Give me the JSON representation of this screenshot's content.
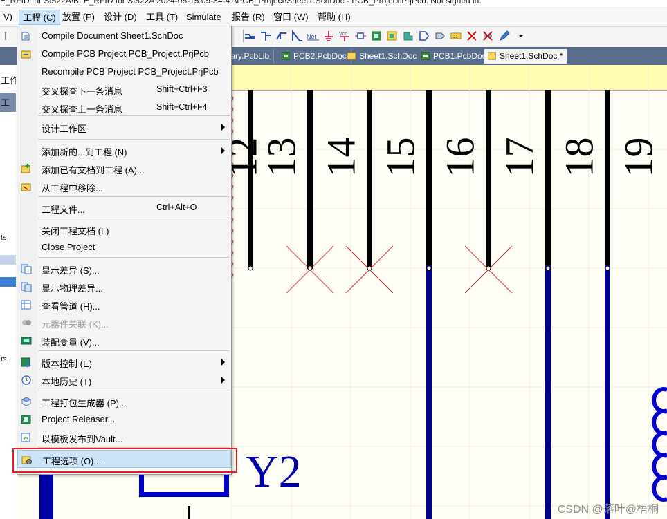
{
  "window_title": "E_RFID for SI522A\\BLE_RFID for SI522A 2024-05-15 09-34-41\\PCB_Project\\Sheet1.SchDoc  - PCB_Project.PrjPcb. Not signed in.",
  "menubar": {
    "items": [
      "V)",
      "工程 (C)",
      "放置 (P)",
      "设计 (D)",
      "工具 (T)",
      "Simulate",
      "报告 (R)",
      "窗口 (W)",
      "帮助 (H)"
    ]
  },
  "tabs": [
    {
      "label": "ibrary.PcbLib"
    },
    {
      "label": "PCB2.PcbDoc"
    },
    {
      "label": "Sheet1.SchDoc"
    },
    {
      "label": "PCB1.PcbDoc"
    },
    {
      "label": "Sheet1.SchDoc *"
    }
  ],
  "left_panel": {
    "labels": [
      "工作",
      "工",
      "ts",
      "ts"
    ]
  },
  "menu": {
    "items": [
      {
        "label": "Compile Document Sheet1.SchDoc",
        "shortcut": "",
        "icon": "compile-icon"
      },
      {
        "label": "Compile PCB Project PCB_Project.PrjPcb",
        "shortcut": "",
        "icon": "compile-project-icon"
      },
      {
        "label": "Recompile PCB Project PCB_Project.PrjPcb",
        "shortcut": "",
        "icon": ""
      },
      {
        "label": "交叉探查下一条消息",
        "shortcut": "Shift+Ctrl+F3",
        "icon": ""
      },
      {
        "label": "交叉探查上一条消息",
        "shortcut": "Shift+Ctrl+F4",
        "icon": ""
      },
      {
        "label": "设计工作区",
        "shortcut": "",
        "icon": ""
      },
      {
        "label": "添加新的...到工程 (N)",
        "shortcut": "",
        "icon": ""
      },
      {
        "label": "添加已有文档到工程 (A)...",
        "shortcut": "",
        "icon": "add-existing-icon"
      },
      {
        "label": "从工程中移除...",
        "shortcut": "",
        "icon": "remove-icon"
      },
      {
        "label": "工程文件...",
        "shortcut": "Ctrl+Alt+O",
        "icon": ""
      },
      {
        "label": "关闭工程文档 (L)",
        "shortcut": "",
        "icon": ""
      },
      {
        "label": "Close Project",
        "shortcut": "",
        "icon": ""
      },
      {
        "label": "显示差异 (S)...",
        "shortcut": "",
        "icon": "diff-icon"
      },
      {
        "label": "显示物理差异...",
        "shortcut": "",
        "icon": "physical-diff-icon"
      },
      {
        "label": "查看管道 (H)...",
        "shortcut": "",
        "icon": "channel-icon"
      },
      {
        "label": "元器件关联 (K)...",
        "shortcut": "",
        "icon": "component-link-icon"
      },
      {
        "label": "装配变量 (V)...",
        "shortcut": "",
        "icon": "variant-icon"
      },
      {
        "label": "版本控制 (E)",
        "shortcut": "",
        "icon": "version-control-icon"
      },
      {
        "label": "本地历史 (T)",
        "shortcut": "",
        "icon": "history-icon"
      },
      {
        "label": "工程打包生成器 (P)...",
        "shortcut": "",
        "icon": "packager-icon"
      },
      {
        "label": "Project Releaser...",
        "shortcut": "",
        "icon": "releaser-icon"
      },
      {
        "label": "以模板发布到Vault...",
        "shortcut": "",
        "icon": "vault-icon"
      },
      {
        "label": "工程选项 (O)...",
        "shortcut": "",
        "icon": "project-options-icon"
      }
    ]
  },
  "schematic": {
    "pin_numbers": [
      "12",
      "13",
      "14",
      "15",
      "16",
      "17",
      "18",
      "19"
    ],
    "designator": "Y2"
  },
  "watermark": "CSDN @落叶@梧桐",
  "colors": {
    "wire_blue": "#00008b",
    "pin_black": "#000000",
    "highlight": "#cce4f7",
    "red_box": "#e02020"
  }
}
